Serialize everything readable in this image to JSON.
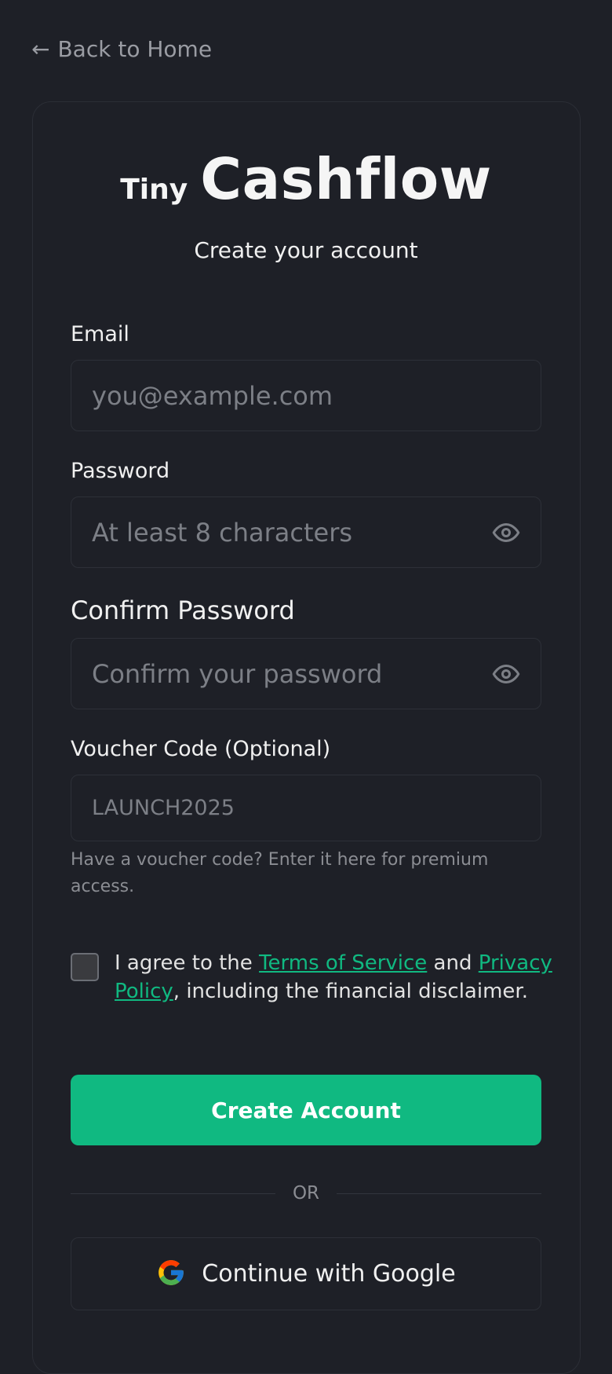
{
  "nav": {
    "back_arrow": "←",
    "back_label": "Back to Home"
  },
  "brand": {
    "tiny": "Tiny",
    "main": "Cashflow"
  },
  "subtitle": "Create your account",
  "form": {
    "email": {
      "label": "Email",
      "placeholder": "you@example.com",
      "value": ""
    },
    "password": {
      "label": "Password",
      "placeholder": "At least 8 characters",
      "value": "",
      "toggle_icon": "eye-icon"
    },
    "confirm_password": {
      "label": "Confirm Password",
      "placeholder": "Confirm your password",
      "value": "",
      "toggle_icon": "eye-icon"
    },
    "voucher": {
      "label": "Voucher Code (Optional)",
      "placeholder": "LAUNCH2025",
      "value": "",
      "hint": "Have a voucher code? Enter it here for premium access."
    },
    "terms": {
      "checked": false,
      "prefix": "I agree to the ",
      "tos_link": "Terms of Service",
      "middle": " and ",
      "privacy_link": "Privacy Policy",
      "suffix": ", including the financial disclaimer."
    },
    "submit_label": "Create Account"
  },
  "divider_label": "OR",
  "google": {
    "label": "Continue with Google",
    "icon": "google-icon"
  },
  "colors": {
    "background": "#1e2027",
    "accent": "#10b981",
    "muted_text": "#7c7f86",
    "border": "#2d3038"
  }
}
